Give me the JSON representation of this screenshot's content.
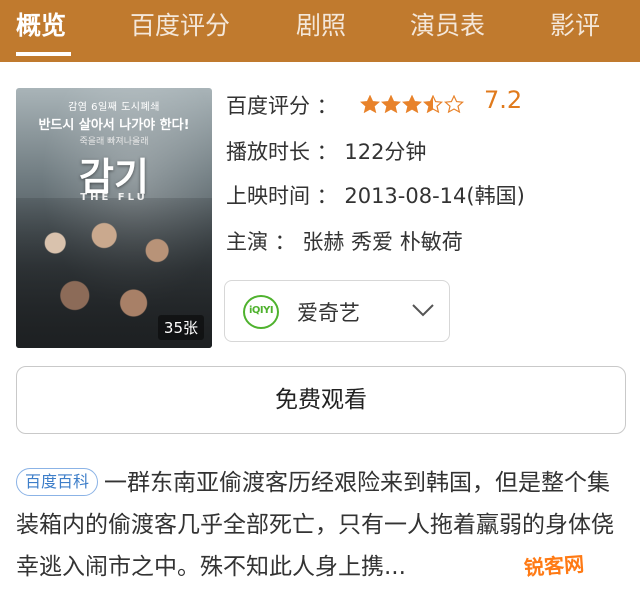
{
  "tabs": [
    {
      "label": "概览",
      "active": true
    },
    {
      "label": "百度评分",
      "active": false
    },
    {
      "label": "剧照",
      "active": false
    },
    {
      "label": "演员表",
      "active": false
    },
    {
      "label": "影评",
      "active": false
    }
  ],
  "colors": {
    "tabbar_bg": "#c07a2e",
    "score": "#e07a1c",
    "star": "#e8822a",
    "iqiyi_green": "#4fb22e"
  },
  "poster": {
    "kr_top": "감염 6일째 도시폐쇄",
    "kr_sub": "반드시 살아서 나가야 한다!",
    "kr_small": "죽을래 빠져나올래",
    "kr_title": "감기",
    "en_title": "THE FLU",
    "photo_count": "35张"
  },
  "info": {
    "rating_label": "百度评分 ：",
    "rating_stars": 3.5,
    "rating_max": 5,
    "score": "7.2",
    "duration": "播放时长 ： 122分钟",
    "release": "上映时间 ： 2013-08-14(韩国)",
    "cast": "主演 ： 张赫 秀爱 朴敏荷"
  },
  "source": {
    "icon_text": "iQIYI",
    "name": "爱奇艺"
  },
  "watch_button": "免费观看",
  "description": {
    "tag": "百度百科",
    "text": "一群东南亚偷渡客历经艰险来到韩国，但是整个集装箱内的偷渡客几乎全部死亡，只有一人拖着羸弱的身体侥幸逃入闹市之中。殊不知此人身上携..."
  },
  "watermark": "锐客网"
}
